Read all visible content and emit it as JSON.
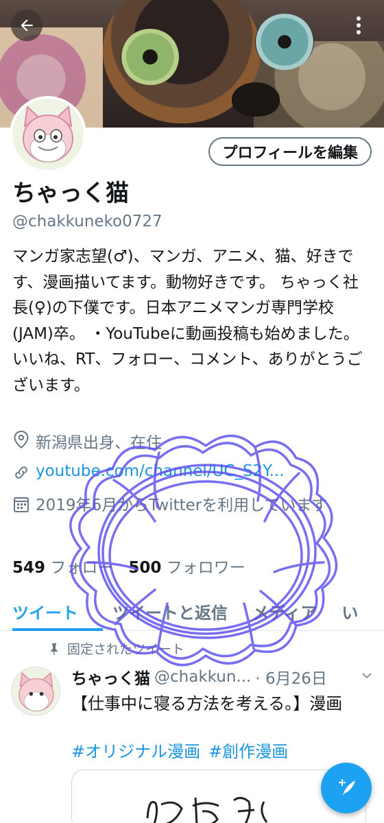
{
  "profile": {
    "name": "ちゃっく猫",
    "handle": "@chakkuneko0727",
    "edit_label": "プロフィールを編集",
    "bio": "マンガ家志望(♂)、マンガ、アニメ、猫、好きです、漫画描いてます。動物好きです。 ちゃっく社長(♀)の下僕です。日本アニメマンガ専門学校(JAM)卒。 ・YouTubeに動画投稿も始めました。 いいね、RT、フォロー、コメント、ありがとうございます。",
    "location": "新潟県出身、在住",
    "link": "youtube.com/channel/UC_S2Y...",
    "joined": "2019年6月からTwitterを利用しています",
    "following_count": "549",
    "following_label": "フォロー",
    "followers_count": "500",
    "followers_label": "フォロワー"
  },
  "tabs": [
    "ツイート",
    "ツイートと返信",
    "メディア",
    "い"
  ],
  "pinned_label": "固定されたツイート",
  "tweet": {
    "name": "ちゃっく猫",
    "handle": "@chakkun...",
    "date": "· 6月26日",
    "text": "【仕事中に寝る方法を考える。】漫画",
    "tags": [
      "#オリジナル漫画",
      "#創作漫画"
    ]
  },
  "icons": {
    "back": "arrow-left-icon",
    "menu": "more-vertical-icon",
    "location": "location-pin-icon",
    "link": "link-icon",
    "calendar": "calendar-icon",
    "pin": "pin-icon",
    "chevron": "chevron-down-icon",
    "compose": "compose-tweet-icon"
  },
  "colors": {
    "accent": "#1da1f2",
    "link": "#1b95e0",
    "muted": "#657786",
    "scribble": "#5b4ff0"
  }
}
